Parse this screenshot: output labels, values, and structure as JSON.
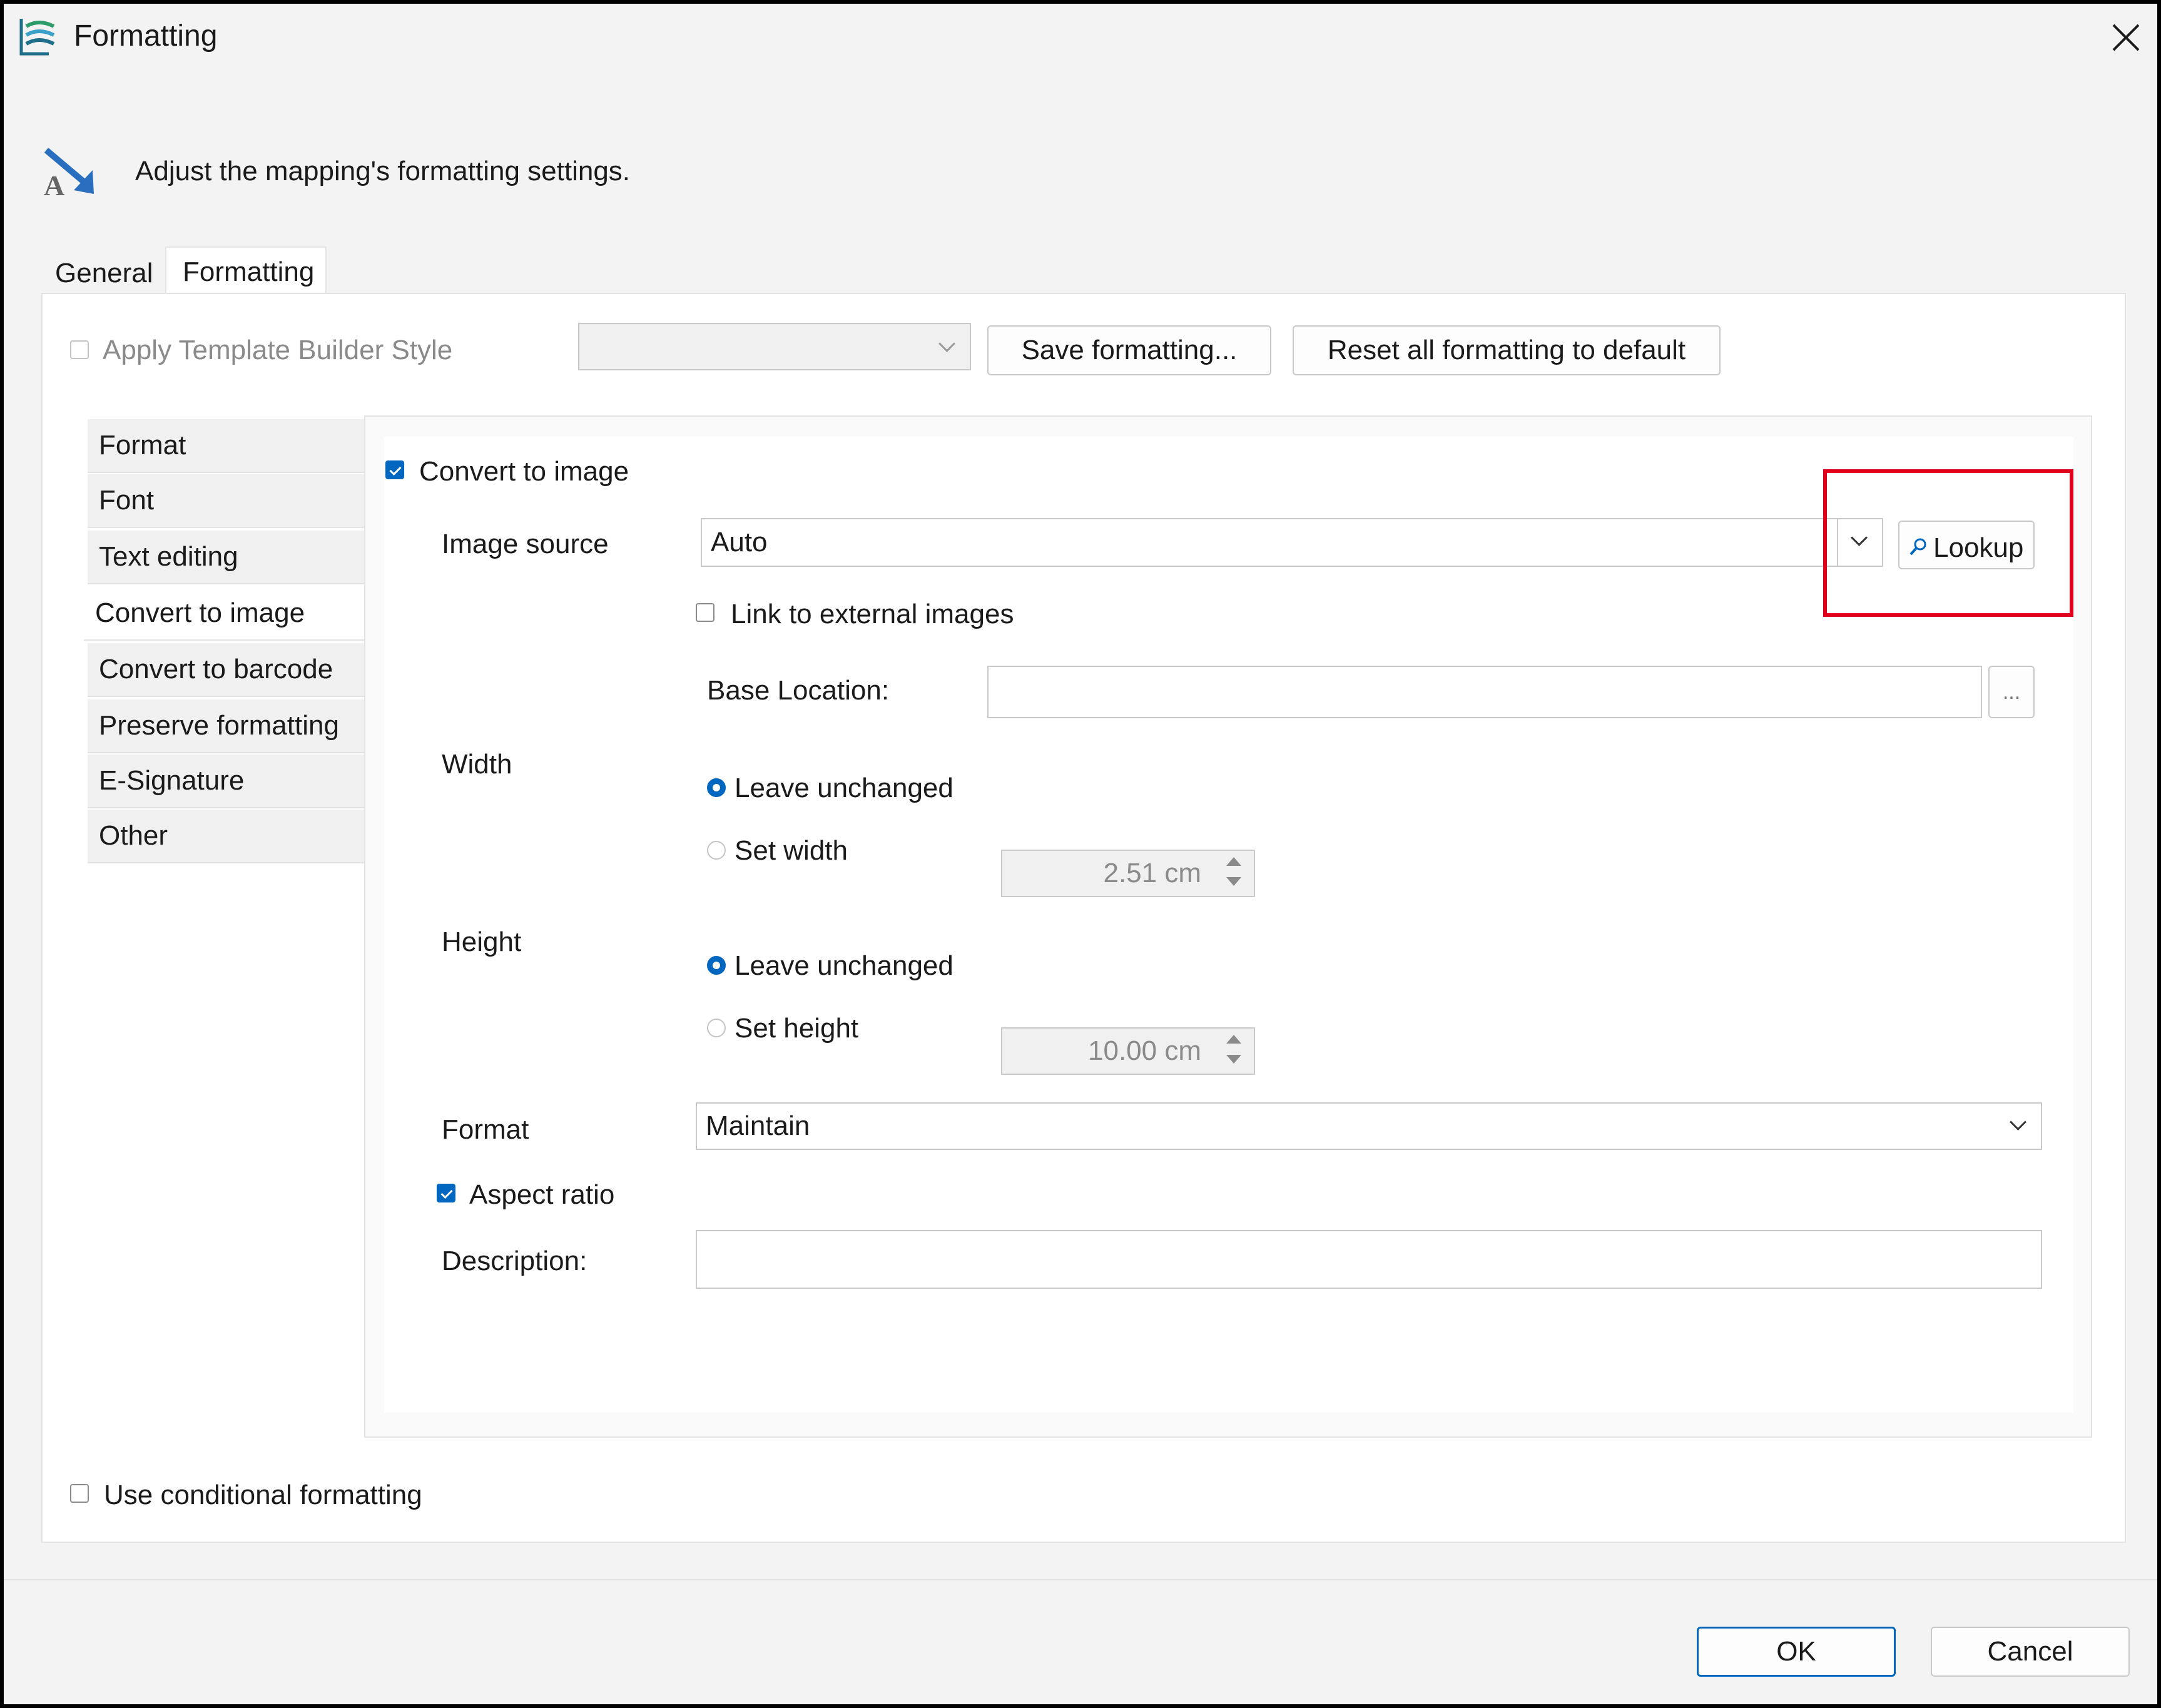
{
  "window": {
    "title": "Formatting",
    "header_text": "Adjust the mapping's formatting settings."
  },
  "tabs": [
    {
      "label": "General"
    },
    {
      "label": "Formatting"
    }
  ],
  "template": {
    "apply_label": "Apply Template Builder Style",
    "save_button": "Save formatting...",
    "reset_button": "Reset all formatting to default"
  },
  "sidebar": {
    "items": [
      {
        "label": "Format"
      },
      {
        "label": "Font"
      },
      {
        "label": "Text editing"
      },
      {
        "label": "Convert to image"
      },
      {
        "label": "Convert to barcode"
      },
      {
        "label": "Preserve formatting"
      },
      {
        "label": "E-Signature"
      },
      {
        "label": "Other"
      }
    ],
    "selected": "Convert to image"
  },
  "convert": {
    "checkbox_label": "Convert to image",
    "image_source_label": "Image source",
    "image_source_value": "Auto",
    "lookup_button": "Lookup",
    "link_external_label": "Link to external images",
    "base_location_label": "Base Location:",
    "base_location_value": "",
    "browse_button": "...",
    "width_label": "Width",
    "width_leave": "Leave unchanged",
    "width_set": "Set width",
    "width_value": "2.51 cm",
    "height_label": "Height",
    "height_leave": "Leave unchanged",
    "height_set": "Set height",
    "height_value": "10.00 cm",
    "format_label": "Format",
    "format_value": "Maintain",
    "aspect_label": "Aspect ratio",
    "description_label": "Description:",
    "description_value": ""
  },
  "footer": {
    "conditional_label": "Use conditional formatting",
    "ok": "OK",
    "cancel": "Cancel"
  },
  "colors": {
    "accent": "#0067c0",
    "highlight_box": "#e0001b"
  }
}
